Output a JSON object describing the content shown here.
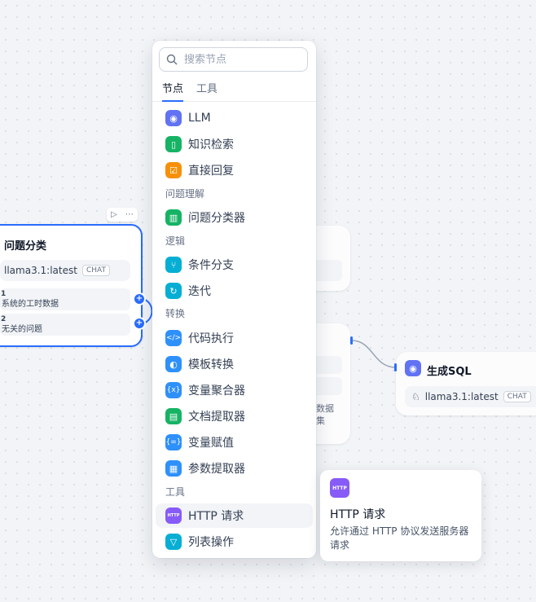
{
  "colors": {
    "accent": "#296dff",
    "llm": "#6172f3",
    "knowledge": "#16b364",
    "answer": "#f79009",
    "classifier": "#16b364",
    "ifelse": "#06aed4",
    "iteration": "#06aed4",
    "code": "#2e90fa",
    "template": "#2e90fa",
    "aggregator": "#2e90fa",
    "doc": "#16b364",
    "assign": "#2e90fa",
    "param": "#2e90fa",
    "http": "#875bf7",
    "list": "#06aed4"
  },
  "classifier_node": {
    "title": "问题分类",
    "model": "llama3.1:latest",
    "model_badge": "CHAT",
    "toolbar_icons": [
      "play-icon",
      "more-icon"
    ],
    "classes": [
      {
        "index": "1",
        "text": "系统的工时数据"
      },
      {
        "index": "2",
        "text": "无关的问题"
      }
    ]
  },
  "partial_node": {
    "text_line1": "数据",
    "text_line2": "集"
  },
  "sql_node": {
    "title": "生成SQL",
    "model": "llama3.1:latest",
    "model_badge": "CHAT"
  },
  "menu": {
    "search_placeholder": "搜索节点",
    "tabs": [
      "节点",
      "工具"
    ],
    "items_top": [
      {
        "label": "LLM",
        "icon": "llm-icon"
      },
      {
        "label": "知识检索",
        "icon": "book-icon"
      },
      {
        "label": "直接回复",
        "icon": "reply-icon"
      }
    ],
    "groups": [
      {
        "title": "问题理解",
        "items": [
          {
            "label": "问题分类器",
            "icon": "classifier-icon"
          }
        ]
      },
      {
        "title": "逻辑",
        "items": [
          {
            "label": "条件分支",
            "icon": "branch-icon"
          },
          {
            "label": "迭代",
            "icon": "iteration-icon"
          }
        ]
      },
      {
        "title": "转换",
        "items": [
          {
            "label": "代码执行",
            "icon": "code-icon"
          },
          {
            "label": "模板转换",
            "icon": "template-icon"
          },
          {
            "label": "变量聚合器",
            "icon": "variable-icon"
          },
          {
            "label": "文档提取器",
            "icon": "document-icon"
          },
          {
            "label": "变量赋值",
            "icon": "assign-icon"
          },
          {
            "label": "参数提取器",
            "icon": "parameter-icon"
          }
        ]
      },
      {
        "title": "工具",
        "items": [
          {
            "label": "HTTP 请求",
            "icon": "http-icon"
          },
          {
            "label": "列表操作",
            "icon": "filter-icon"
          }
        ]
      }
    ]
  },
  "tooltip": {
    "icon_text": "HTTP",
    "title": "HTTP 请求",
    "description": "允许通过 HTTP 协议发送服务器请求"
  }
}
